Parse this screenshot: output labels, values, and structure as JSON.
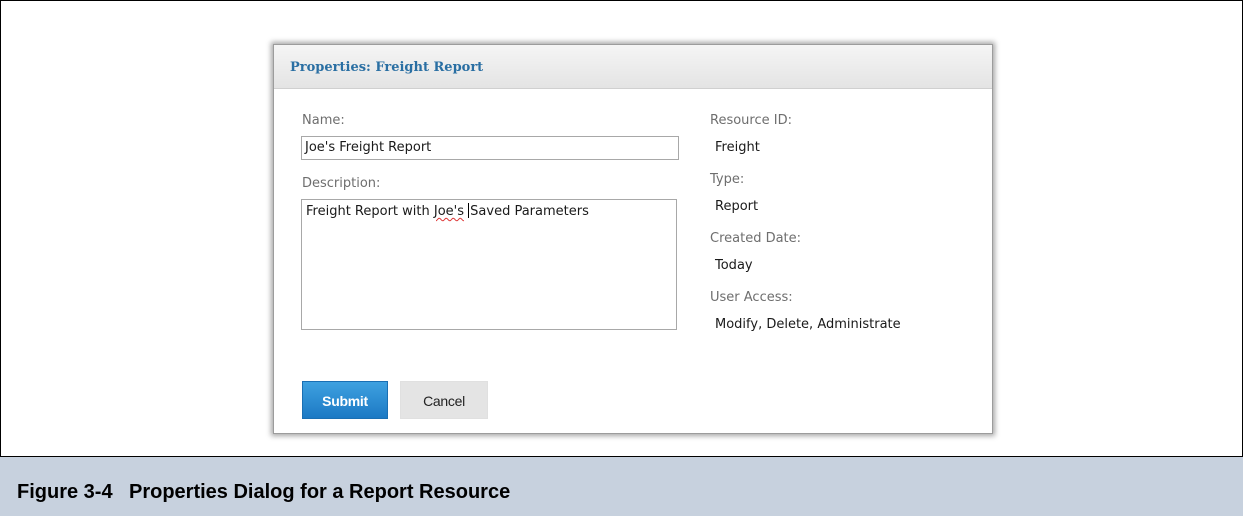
{
  "dialog": {
    "title": "Properties: Freight Report",
    "name_label": "Name:",
    "name_value": "Joe's Freight Report",
    "description_label": "Description:",
    "description_before": "Freight Report with ",
    "description_misspelled": "Joe's",
    "description_after": "Saved Parameters",
    "resource_id_label": "Resource ID:",
    "resource_id_value": "Freight",
    "type_label": "Type:",
    "type_value": "Report",
    "created_label": "Created Date:",
    "created_value": "Today",
    "access_label": "User Access:",
    "access_value": "Modify, Delete, Administrate",
    "submit_label": "Submit",
    "cancel_label": "Cancel"
  },
  "caption": {
    "number": "Figure 3-4",
    "text": "Properties Dialog for a Report Resource"
  },
  "colors": {
    "title": "#2a6fa3",
    "submit_bg": "#2488d0",
    "caption_bg": "#c7d1de"
  }
}
